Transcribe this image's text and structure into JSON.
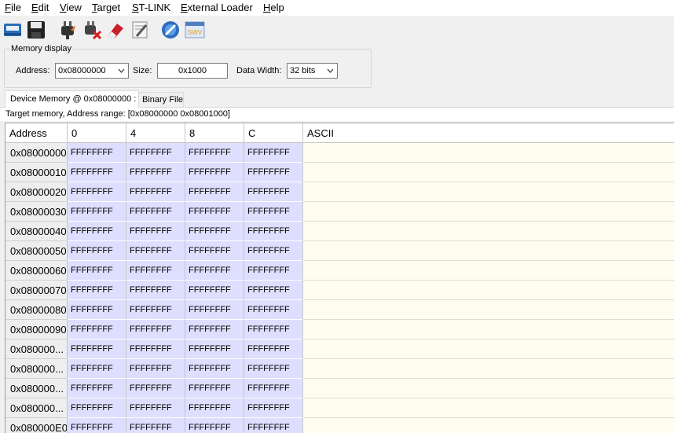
{
  "menu": [
    "File",
    "Edit",
    "View",
    "Target",
    "ST-LINK",
    "External Loader",
    "Help"
  ],
  "toolbar": {
    "icons": [
      "connect-icon",
      "save-icon",
      "plug-icon",
      "disconnect-icon",
      "erase-icon",
      "settings-icon",
      "program-icon",
      "swv-icon"
    ],
    "swv_label": "SWV"
  },
  "memory_display": {
    "title": "Memory display",
    "address_label": "Address:",
    "address_value": "0x08000000",
    "size_label": "Size:",
    "size_value": "0x1000",
    "data_width_label": "Data Width:",
    "data_width_value": "32 bits"
  },
  "tabs": [
    "Device Memory @ 0x08000000 :",
    "Binary File"
  ],
  "info": "Target memory, Address range: [0x08000000 0x08001000]",
  "table": {
    "columns": [
      "Address",
      "0",
      "4",
      "8",
      "C",
      "ASCII"
    ],
    "rows": [
      {
        "address": "0x08000000",
        "values": [
          "FFFFFFFF",
          "FFFFFFFF",
          "FFFFFFFF",
          "FFFFFFFF"
        ]
      },
      {
        "address": "0x08000010",
        "values": [
          "FFFFFFFF",
          "FFFFFFFF",
          "FFFFFFFF",
          "FFFFFFFF"
        ]
      },
      {
        "address": "0x08000020",
        "values": [
          "FFFFFFFF",
          "FFFFFFFF",
          "FFFFFFFF",
          "FFFFFFFF"
        ]
      },
      {
        "address": "0x08000030",
        "values": [
          "FFFFFFFF",
          "FFFFFFFF",
          "FFFFFFFF",
          "FFFFFFFF"
        ]
      },
      {
        "address": "0x08000040",
        "values": [
          "FFFFFFFF",
          "FFFFFFFF",
          "FFFFFFFF",
          "FFFFFFFF"
        ]
      },
      {
        "address": "0x08000050",
        "values": [
          "FFFFFFFF",
          "FFFFFFFF",
          "FFFFFFFF",
          "FFFFFFFF"
        ]
      },
      {
        "address": "0x08000060",
        "values": [
          "FFFFFFFF",
          "FFFFFFFF",
          "FFFFFFFF",
          "FFFFFFFF"
        ]
      },
      {
        "address": "0x08000070",
        "values": [
          "FFFFFFFF",
          "FFFFFFFF",
          "FFFFFFFF",
          "FFFFFFFF"
        ]
      },
      {
        "address": "0x08000080",
        "values": [
          "FFFFFFFF",
          "FFFFFFFF",
          "FFFFFFFF",
          "FFFFFFFF"
        ]
      },
      {
        "address": "0x08000090",
        "values": [
          "FFFFFFFF",
          "FFFFFFFF",
          "FFFFFFFF",
          "FFFFFFFF"
        ]
      },
      {
        "address": "0x080000...",
        "values": [
          "FFFFFFFF",
          "FFFFFFFF",
          "FFFFFFFF",
          "FFFFFFFF"
        ]
      },
      {
        "address": "0x080000...",
        "values": [
          "FFFFFFFF",
          "FFFFFFFF",
          "FFFFFFFF",
          "FFFFFFFF"
        ]
      },
      {
        "address": "0x080000...",
        "values": [
          "FFFFFFFF",
          "FFFFFFFF",
          "FFFFFFFF",
          "FFFFFFFF"
        ]
      },
      {
        "address": "0x080000...",
        "values": [
          "FFFFFFFF",
          "FFFFFFFF",
          "FFFFFFFF",
          "FFFFFFFF"
        ]
      },
      {
        "address": "0x080000E0",
        "values": [
          "FFFFFFFF",
          "FFFFFFFF",
          "FFFFFFFF",
          "FFFFFFFF"
        ]
      }
    ]
  }
}
